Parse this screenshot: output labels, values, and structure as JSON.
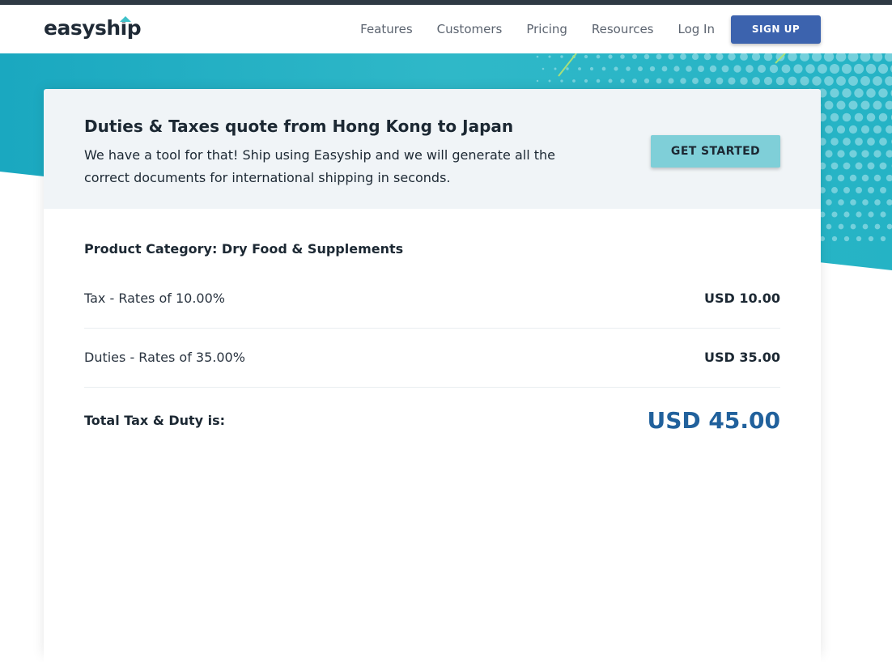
{
  "header": {
    "logo_text": "easyship",
    "nav": [
      "Features",
      "Customers",
      "Pricing",
      "Resources",
      "Log In"
    ],
    "signup_label": "SIGN UP"
  },
  "quote": {
    "title": "Duties & Taxes quote from Hong Kong to Japan",
    "description": "We have a tool for that! Ship using Easyship and we will generate all the correct documents for international shipping in seconds.",
    "cta_label": "GET STARTED"
  },
  "breakdown": {
    "category": "Product Category: Dry Food & Supplements",
    "rows": [
      {
        "label": "Tax - Rates of 10.00%",
        "value": "USD 10.00"
      },
      {
        "label": "Duties - Rates of 35.00%",
        "value": "USD 35.00"
      }
    ],
    "total_label": "Total Tax & Duty is:",
    "total_value": "USD 45.00"
  },
  "colors": {
    "brand_blue": "#3c63ae",
    "accent_teal": "#3fc1c9",
    "cta_teal": "#7fcfd8",
    "total_blue": "#21619c",
    "card_header_bg": "#f0f4f7"
  }
}
